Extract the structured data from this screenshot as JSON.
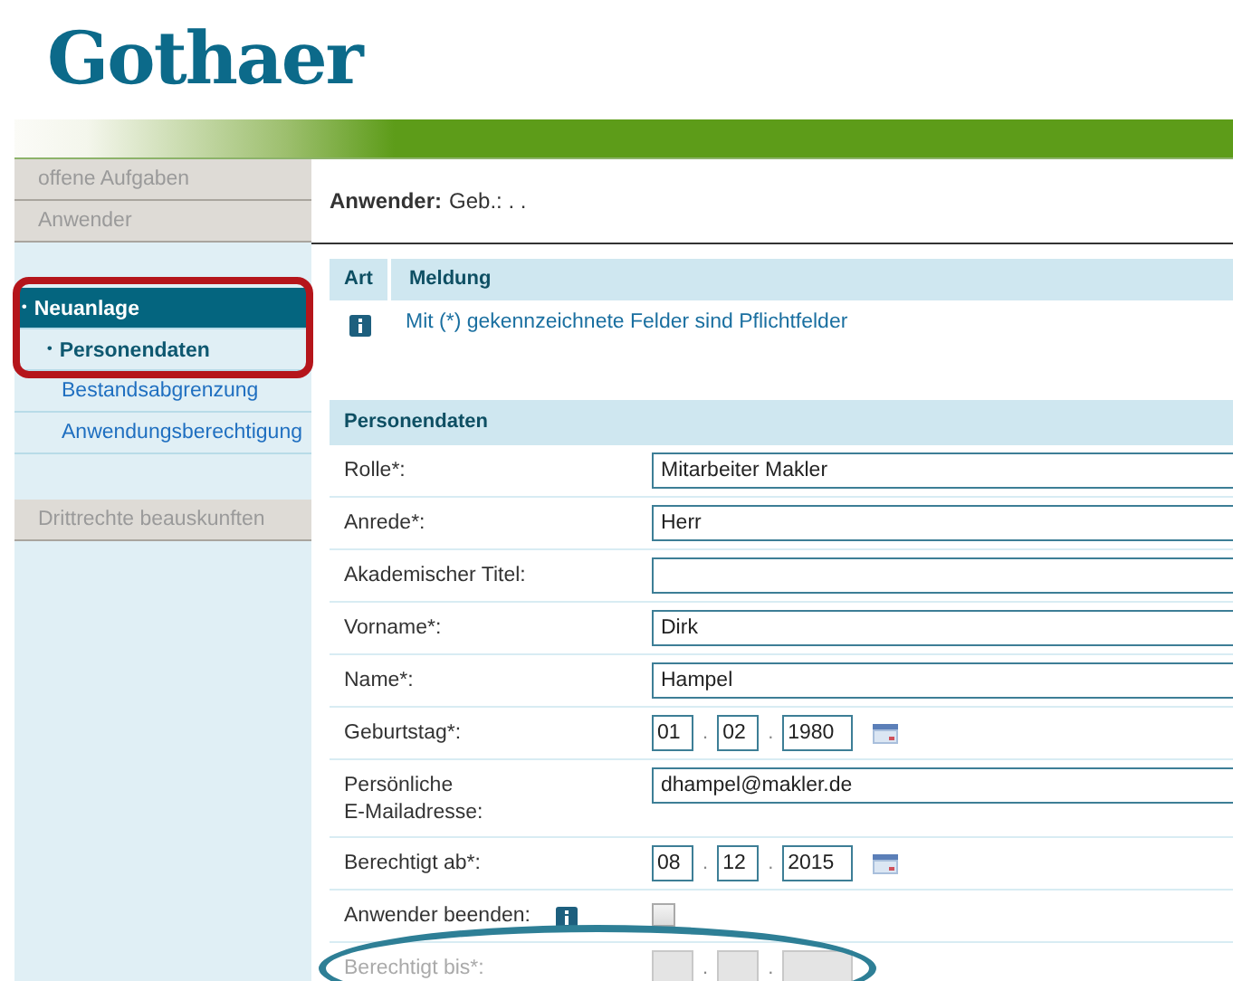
{
  "logo": "Gothaer",
  "sidebar": {
    "items": [
      {
        "label": "offene Aufgaben",
        "kind": "grey",
        "selected": false,
        "framed": false
      },
      {
        "label": "Anwender",
        "kind": "grey",
        "selected": false,
        "framed": false
      },
      {
        "kind": "gap"
      },
      {
        "label": "Neuanlage",
        "kind": "section",
        "selected": true,
        "framed": true,
        "bullet": "•"
      },
      {
        "label": "Personendaten",
        "kind": "sub",
        "selected": true,
        "framed": true,
        "bullet": "•"
      },
      {
        "label": "Bestandsabgrenzung",
        "kind": "sub",
        "selected": false,
        "framed": false
      },
      {
        "label": "Anwendungsberechtigung",
        "kind": "sub",
        "selected": false,
        "framed": false
      },
      {
        "kind": "gap"
      },
      {
        "label": "Drittrechte beauskunften",
        "kind": "grey",
        "selected": false,
        "framed": false
      }
    ]
  },
  "header": {
    "label": "Anwender:",
    "value": "Geb.: . ."
  },
  "messages": {
    "columns": [
      "Art",
      "Meldung"
    ],
    "rows": [
      {
        "text": "Mit (*) gekennzeichnete Felder sind Pflichtfelder"
      }
    ]
  },
  "form": {
    "title": "Personendaten",
    "rows": [
      {
        "label": "Rolle*:",
        "kind": "text",
        "value": "Mitarbeiter Makler",
        "circled": false
      },
      {
        "label": "Anrede*:",
        "kind": "text",
        "value": "Herr",
        "circled": false
      },
      {
        "label": "Akademischer Titel:",
        "kind": "text",
        "circled": false
      },
      {
        "label": "Vorname*:",
        "kind": "text",
        "value": "Dirk",
        "circled": false
      },
      {
        "label": "Name*:",
        "kind": "text",
        "value": "Hampel",
        "circled": false
      },
      {
        "label": "Geburtstag*:",
        "kind": "date",
        "day": "01",
        "month": "02",
        "year": "1980",
        "separator": ".",
        "disabled": false,
        "circled": false
      },
      {
        "label": "Persönliche E-Mailadresse:",
        "kind": "text",
        "value": "dhampel@makler.de",
        "circled": false
      },
      {
        "label": "Berechtigt ab*:",
        "kind": "date",
        "day": "08",
        "month": "12",
        "year": "2015",
        "separator": ".",
        "disabled": false,
        "circled": false
      },
      {
        "label": "Anwender beenden:",
        "kind": "checkbox",
        "checked": false,
        "circled": false
      },
      {
        "label": "Berechtigt bis*:",
        "kind": "date",
        "separator": ".",
        "disabled": true,
        "circled": true
      }
    ]
  }
}
